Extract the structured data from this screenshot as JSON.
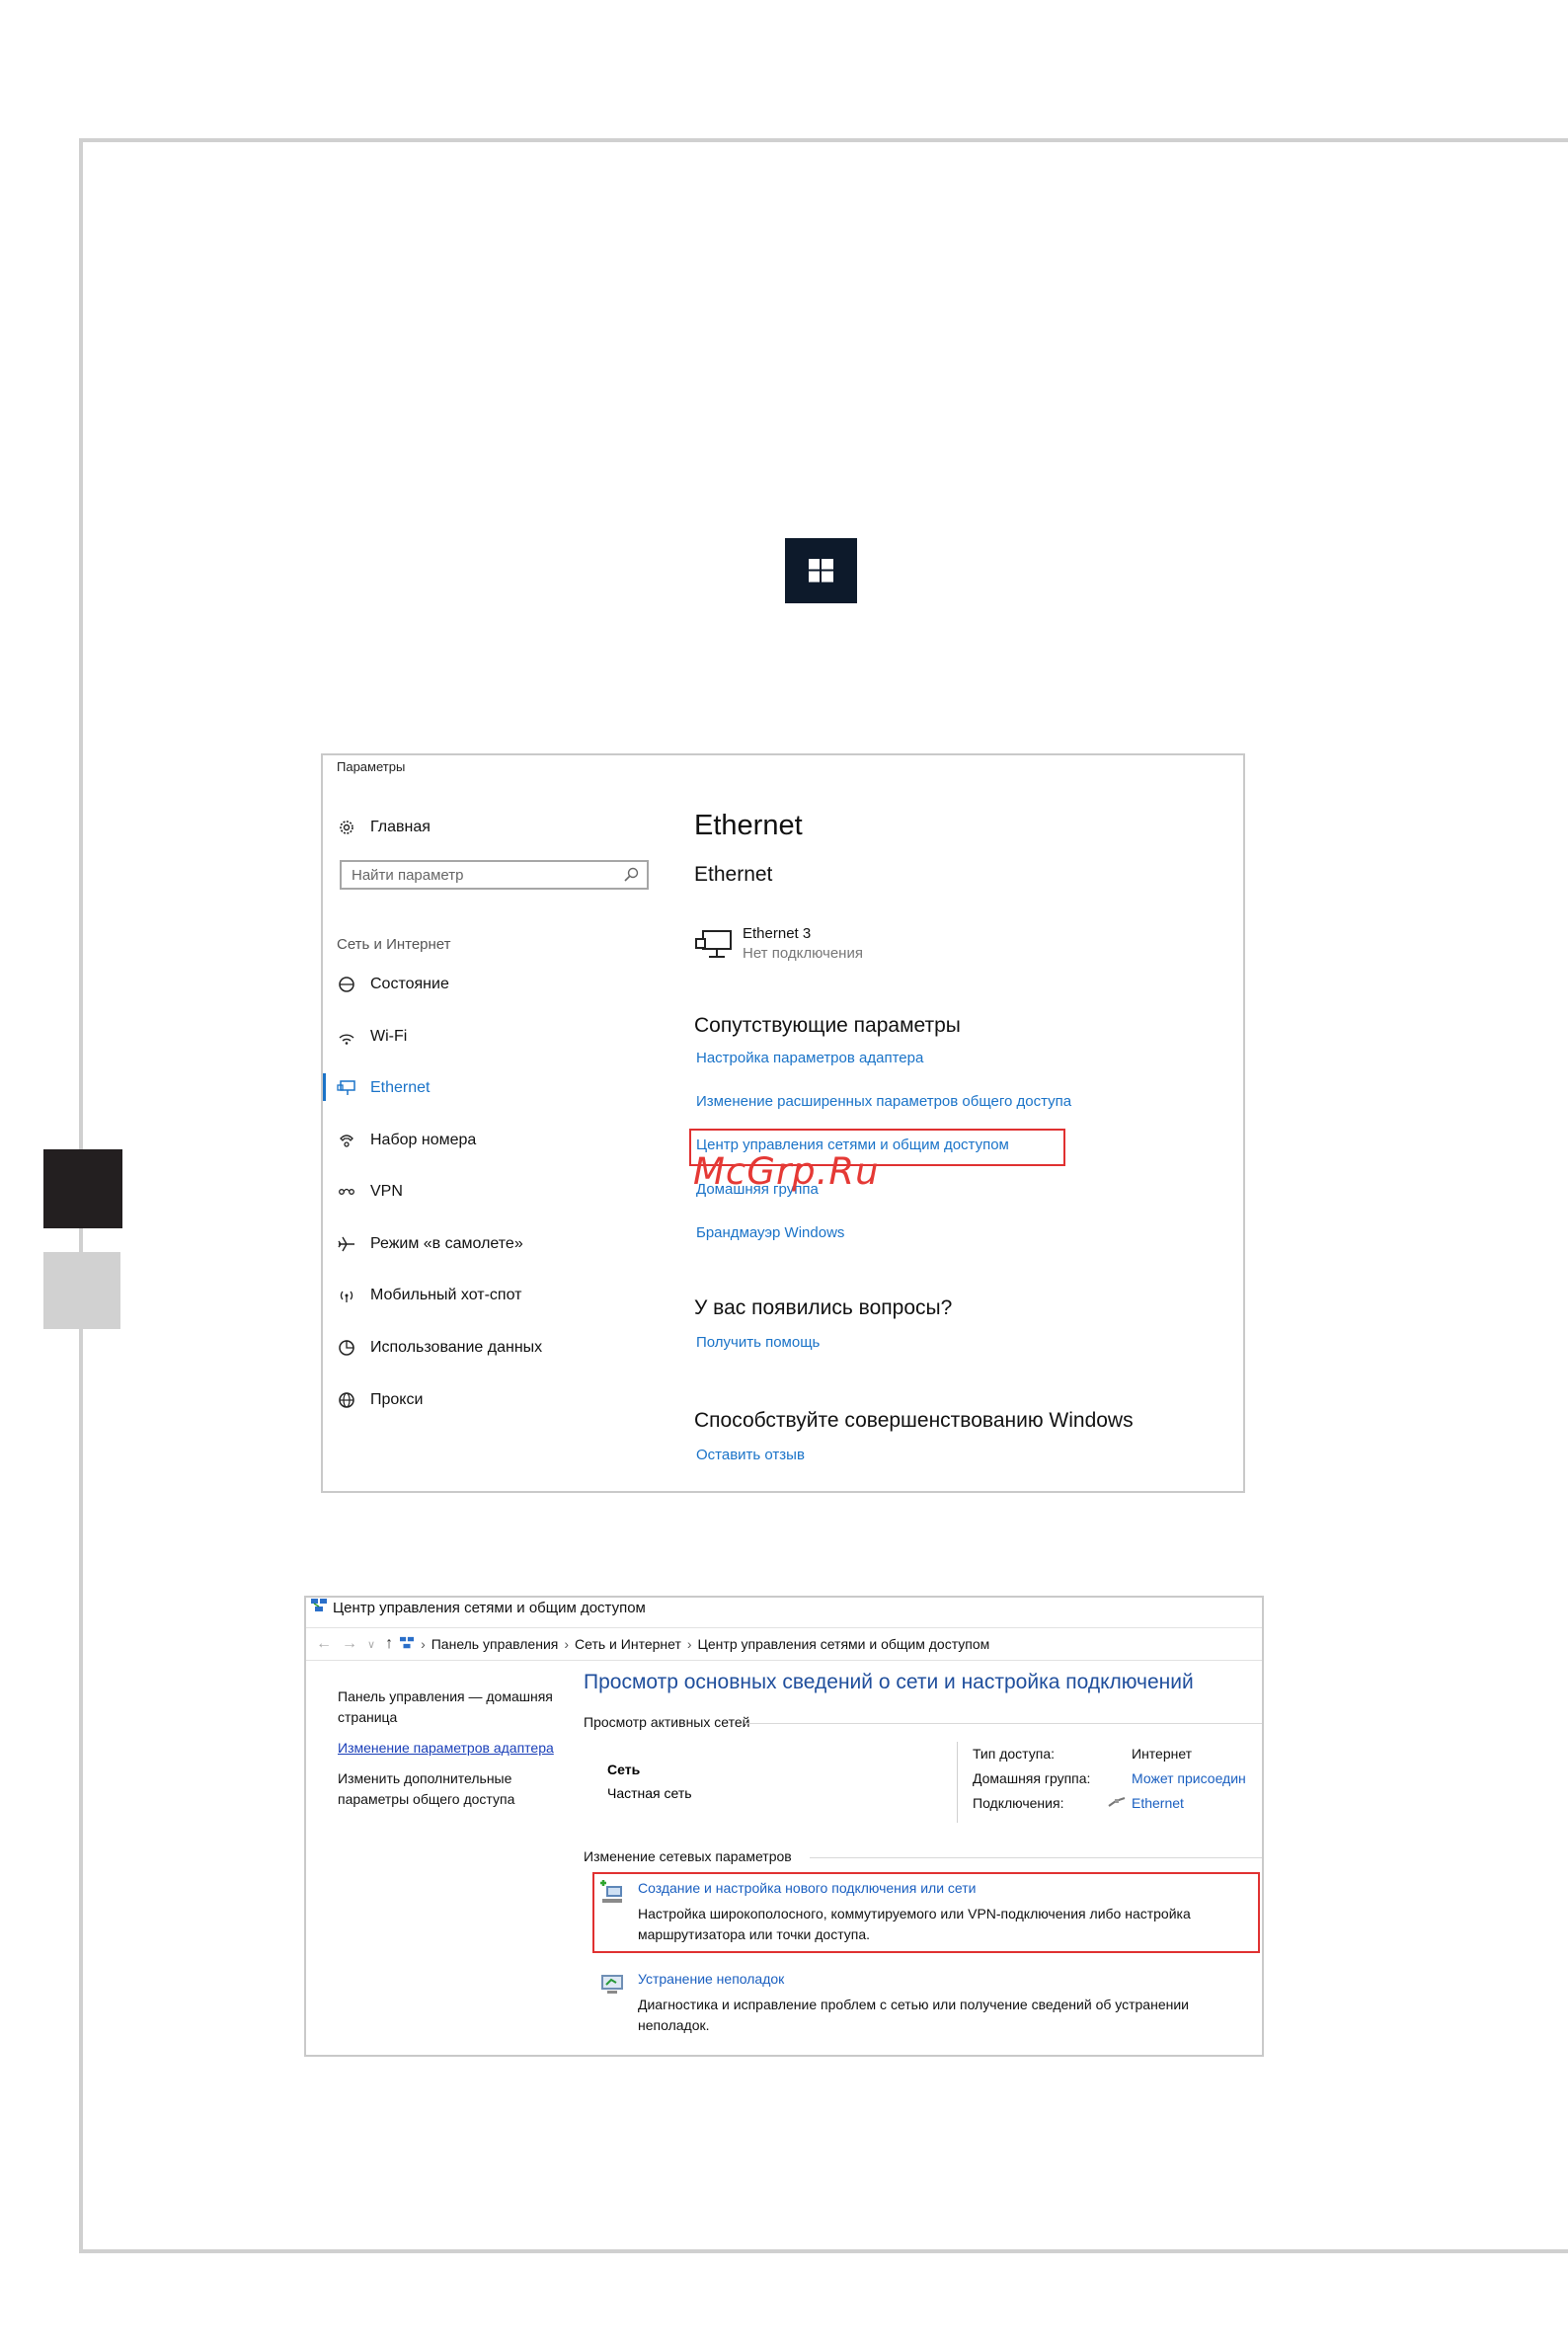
{
  "settings": {
    "window_title": "Параметры",
    "home": "Главная",
    "search_placeholder": "Найти параметр",
    "section": "Сеть и Интернет",
    "nav": [
      {
        "label": "Состояние",
        "icon": "status-icon"
      },
      {
        "label": "Wi-Fi",
        "icon": "wifi-icon"
      },
      {
        "label": "Ethernet",
        "icon": "ethernet-icon",
        "active": true
      },
      {
        "label": "Набор номера",
        "icon": "dialup-icon"
      },
      {
        "label": "VPN",
        "icon": "vpn-icon"
      },
      {
        "label": "Режим «в самолете»",
        "icon": "airplane-icon"
      },
      {
        "label": "Мобильный хот-спот",
        "icon": "hotspot-icon"
      },
      {
        "label": "Использование данных",
        "icon": "data-usage-icon"
      },
      {
        "label": "Прокси",
        "icon": "globe-icon"
      }
    ],
    "page_title": "Ethernet",
    "subtitle": "Ethernet",
    "adapter_name": "Ethernet 3",
    "adapter_status": "Нет подключения",
    "related_heading": "Сопутствующие параметры",
    "related_links": [
      "Настройка параметров адаптера",
      "Изменение расширенных параметров общего доступа",
      "Центр управления сетями и общим доступом",
      "Домашняя группа",
      "Брандмауэр Windows"
    ],
    "questions_heading": "У вас появились вопросы?",
    "help_link": "Получить помощь",
    "improve_heading": "Способствуйте совершенствованию Windows",
    "feedback_link": "Оставить отзыв",
    "watermark": "McGrp.Ru",
    "accent": "#1a73c8"
  },
  "netcenter": {
    "window_title": "Центр управления сетями и общим доступом",
    "breadcrumb": [
      "Панель управления",
      "Сеть и Интернет",
      "Центр управления сетями и общим доступом"
    ],
    "left_links": [
      "Панель управления — домашняя страница",
      "Изменение параметров адаптера",
      "Изменить дополнительные параметры общего доступа"
    ],
    "title": "Просмотр основных сведений о сети и настройка подключений",
    "active_networks": "Просмотр активных сетей",
    "network_name": "Сеть",
    "network_type": "Частная сеть",
    "access_type_label": "Тип доступа:",
    "access_type_value": "Интернет",
    "homegroup_label": "Домашняя группа:",
    "homegroup_value": "Может присоедин",
    "connections_label": "Подключения:",
    "connections_value": "Ethernet",
    "change_settings": "Изменение сетевых параметров",
    "task1_link": "Создание и настройка нового подключения или сети",
    "task1_desc1": "Настройка широкополосного, коммутируемого или VPN-подключения либо настройка",
    "task1_desc2": "маршрутизатора или точки доступа.",
    "task2_link": "Устранение неполадок",
    "task2_desc1": "Диагностика и исправление проблем с сетью или получение сведений об устранении",
    "task2_desc2": "неполадок."
  }
}
